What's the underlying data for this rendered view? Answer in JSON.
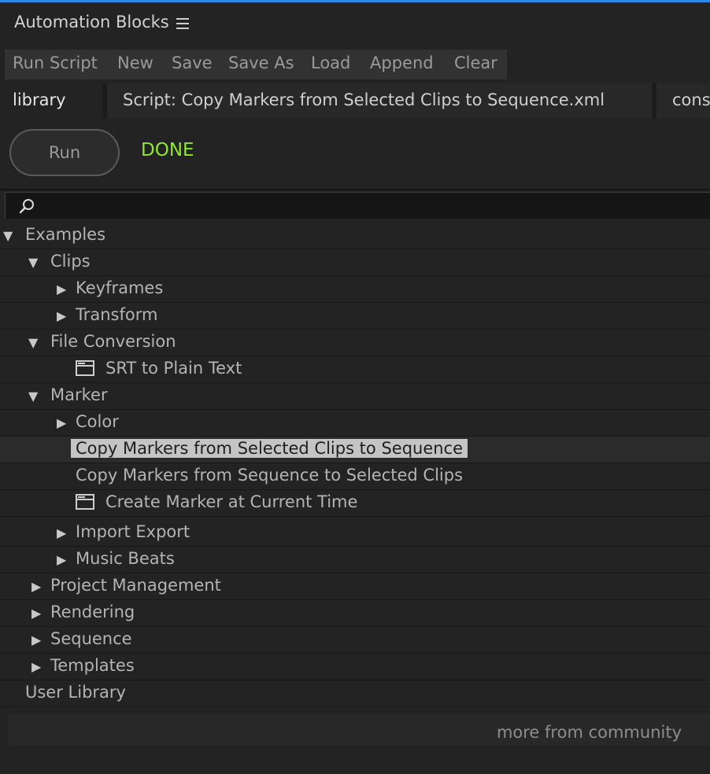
{
  "app": {
    "title": "Automation Blocks"
  },
  "toolbar": [
    "Run Script",
    "New",
    "Save",
    "Save As",
    "Load",
    "Append",
    "Clear"
  ],
  "tabs": {
    "library": "library",
    "script": "Script: Copy Markers from Selected Clips to Sequence.xml",
    "console": "cons"
  },
  "run": {
    "label": "Run",
    "status": "DONE",
    "status_color": "#8ee82e"
  },
  "search": {
    "value": "",
    "placeholder": ""
  },
  "tree": [
    {
      "label": "Examples",
      "caret": "expanded"
    },
    {
      "label": "Clips",
      "caret": "expanded"
    },
    {
      "label": "Keyframes",
      "caret": "collapsed"
    },
    {
      "label": "Transform",
      "caret": "collapsed"
    },
    {
      "label": "File Conversion",
      "caret": "expanded"
    },
    {
      "label": "SRT to Plain Text",
      "icon": "script-file-icon"
    },
    {
      "label": "Marker",
      "caret": "expanded"
    },
    {
      "label": "Color",
      "caret": "collapsed"
    },
    {
      "label": "Copy Markers from Selected Clips to Sequence",
      "selected": true
    },
    {
      "label": "Copy Markers from Sequence to Selected Clips"
    },
    {
      "label": "Create Marker at Current Time",
      "icon": "script-file-icon"
    },
    {
      "label": "Import Export",
      "caret": "collapsed"
    },
    {
      "label": "Music Beats",
      "caret": "collapsed"
    },
    {
      "label": "Project Management",
      "caret": "collapsed"
    },
    {
      "label": "Rendering",
      "caret": "collapsed"
    },
    {
      "label": "Sequence",
      "caret": "collapsed"
    },
    {
      "label": "Templates",
      "caret": "collapsed"
    },
    {
      "label": "User Library"
    }
  ],
  "footer": {
    "more_link": "more from community"
  }
}
